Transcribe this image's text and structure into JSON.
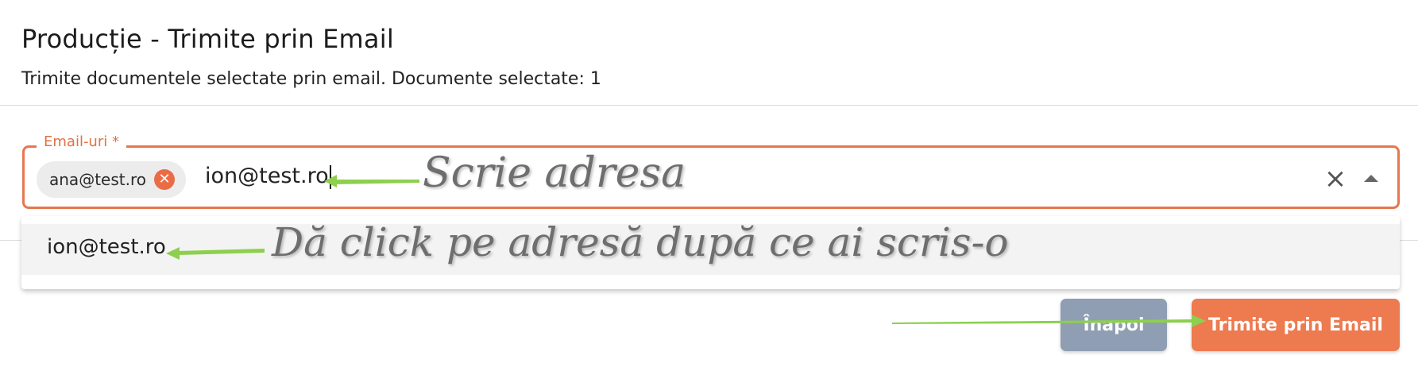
{
  "header": {
    "title": "Producție - Trimite prin Email",
    "subtitle": "Trimite documentele selectate prin email. Documente selectate: 1"
  },
  "email_field": {
    "label": "Email-uri *",
    "chips": [
      {
        "label": "ana@test.ro",
        "remove_icon": "close-circle-icon"
      }
    ],
    "input_value": "ion@test.ro",
    "clear_icon": "close-icon",
    "toggle_icon": "arrow-up-icon"
  },
  "dropdown": {
    "options": [
      {
        "label": "ion@test.ro"
      }
    ]
  },
  "buttons": {
    "back_label": "Înapoi",
    "send_label": "Trimite prin Email"
  },
  "annotations": {
    "type_hint": "Scrie adresa",
    "click_hint": "Dă click pe adresă după ce ai scris-o",
    "arrow_color": "#8dcf4e"
  },
  "colors": {
    "accent": "#e8764f",
    "send_button": "#ee7a50",
    "back_button": "#8f9eb2"
  }
}
